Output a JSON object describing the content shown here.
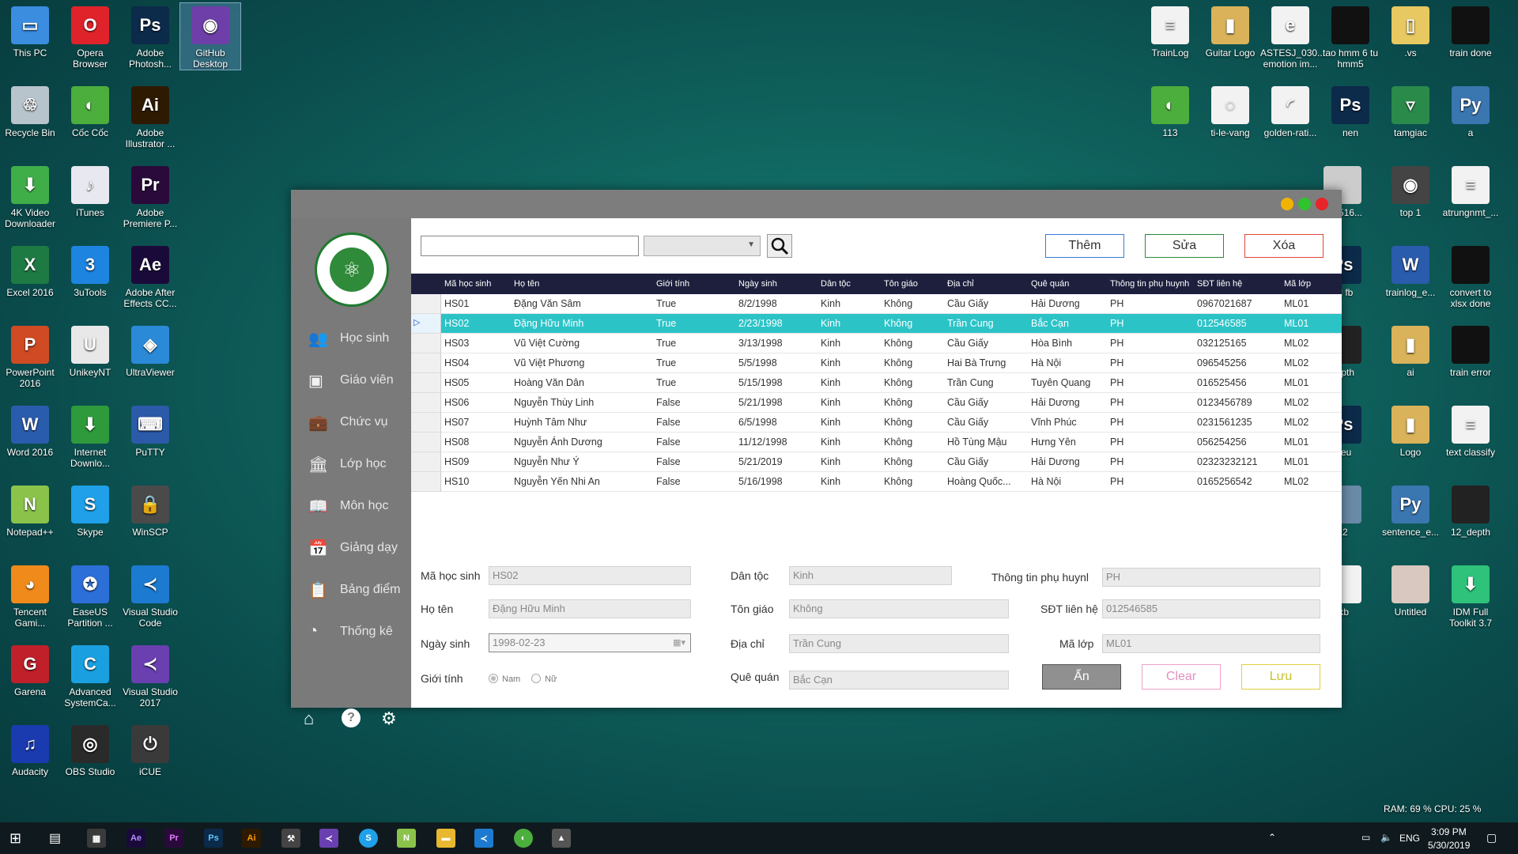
{
  "desktop": {
    "left_icons": [
      {
        "label": "This PC",
        "color": "#3b8de0",
        "glyph": "▭"
      },
      {
        "label": "Opera Browser",
        "color": "#e0232b",
        "glyph": "O"
      },
      {
        "label": "Adobe Photosh...",
        "color": "#0c2a4a",
        "glyph": "Ps"
      },
      {
        "label": "GitHub Desktop",
        "color": "#6e3fa8",
        "glyph": "◉"
      },
      {
        "label": "Recycle Bin",
        "color": "#b8c4cc",
        "glyph": "♲"
      },
      {
        "label": "Cốc Cốc",
        "color": "#4cae3c",
        "glyph": "◐"
      },
      {
        "label": "Adobe Illustrator ...",
        "color": "#2e1a00",
        "glyph": "Ai"
      },
      {
        "label": "4K Video Downloader",
        "color": "#3fae49",
        "glyph": "⬇"
      },
      {
        "label": "iTunes",
        "color": "#e8e8f0",
        "glyph": "♪"
      },
      {
        "label": "Adobe Premiere P...",
        "color": "#2a0a3a",
        "glyph": "Pr"
      },
      {
        "label": "Excel 2016",
        "color": "#1e7a43",
        "glyph": "X"
      },
      {
        "label": "3uTools",
        "color": "#1d84e0",
        "glyph": "3"
      },
      {
        "label": "Adobe After Effects CC...",
        "color": "#1a0a3a",
        "glyph": "Ae"
      },
      {
        "label": "PowerPoint 2016",
        "color": "#d04a24",
        "glyph": "P"
      },
      {
        "label": "UnikeyNT",
        "color": "#e8e8e8",
        "glyph": "U"
      },
      {
        "label": "UltraViewer",
        "color": "#2b8ad8",
        "glyph": "◈"
      },
      {
        "label": "Word 2016",
        "color": "#2a5cad",
        "glyph": "W"
      },
      {
        "label": "Internet Downlo...",
        "color": "#2e9a3c",
        "glyph": "⬇"
      },
      {
        "label": "PuTTY",
        "color": "#2b5aa8",
        "glyph": "⌨"
      },
      {
        "label": "Notepad++",
        "color": "#8bc34a",
        "glyph": "N"
      },
      {
        "label": "Skype",
        "color": "#1fa0e8",
        "glyph": "S"
      },
      {
        "label": "WinSCP",
        "color": "#4a4a4a",
        "glyph": "🔒"
      },
      {
        "label": "Tencent Gami...",
        "color": "#f08a1a",
        "glyph": "◕"
      },
      {
        "label": "EaseUS Partition ...",
        "color": "#2d6fd8",
        "glyph": "✪"
      },
      {
        "label": "Visual Studio Code",
        "color": "#1c7ad0",
        "glyph": "≺"
      },
      {
        "label": "Garena",
        "color": "#c0202a",
        "glyph": "G"
      },
      {
        "label": "Advanced SystemCa...",
        "color": "#1aa0e0",
        "glyph": "C"
      },
      {
        "label": "Visual Studio 2017",
        "color": "#6a3fb0",
        "glyph": "≺"
      },
      {
        "label": "Audacity",
        "color": "#1a3ab0",
        "glyph": "♫"
      },
      {
        "label": "OBS Studio",
        "color": "#2a2a2a",
        "glyph": "◎"
      },
      {
        "label": "iCUE",
        "color": "#3a3a3a",
        "glyph": "⏻"
      }
    ],
    "right_icons": [
      {
        "label": "TrainLog",
        "color": "#f2f2f2",
        "glyph": "≡"
      },
      {
        "label": "Guitar Logo",
        "color": "#d9b25a",
        "glyph": "▮"
      },
      {
        "label": "ASTESJ_030... emotion im...",
        "color": "#f2f2f2",
        "glyph": "e"
      },
      {
        "label": "tao hmm 6 tu hmm5",
        "color": "#111111",
        "glyph": ""
      },
      {
        "label": ".vs",
        "color": "#e8c860",
        "glyph": "▯"
      },
      {
        "label": "train done",
        "color": "#111111",
        "glyph": ""
      },
      {
        "label": "113",
        "color": "#4cae3c",
        "glyph": "◐"
      },
      {
        "label": "ti-le-vang",
        "color": "#f2f2f2",
        "glyph": "◌"
      },
      {
        "label": "golden-rati...",
        "color": "#f2f2f2",
        "glyph": "◜"
      },
      {
        "label": "nen",
        "color": "#0c2a4a",
        "glyph": "Ps"
      },
      {
        "label": "tamgiac",
        "color": "#2a8a4a",
        "glyph": "▿"
      },
      {
        "label": "a",
        "color": "#3a76b0",
        "glyph": "Py"
      },
      {
        "label": "794516...",
        "color": "#cccccc",
        "glyph": ""
      },
      {
        "label": "top 1",
        "color": "#444444",
        "glyph": "◉"
      },
      {
        "label": "atrungnmt_...",
        "color": "#f2f2f2",
        "glyph": "≡"
      },
      {
        "label": "3d fb",
        "color": "#0c2a4a",
        "glyph": "Ps"
      },
      {
        "label": "trainlog_e...",
        "color": "#2a5cad",
        "glyph": "W"
      },
      {
        "label": "convert to xlsx done",
        "color": "#111111",
        "glyph": ""
      },
      {
        "label": "depth",
        "color": "#222222",
        "glyph": ""
      },
      {
        "label": "ai",
        "color": "#d9b25a",
        "glyph": "▮"
      },
      {
        "label": "train error",
        "color": "#111111",
        "glyph": ""
      },
      {
        "label": "hieu",
        "color": "#0c2a4a",
        "glyph": "Ps"
      },
      {
        "label": "Logo",
        "color": "#d9b25a",
        "glyph": "▮"
      },
      {
        "label": "text classify",
        "color": "#f2f2f2",
        "glyph": "≡"
      },
      {
        "label": "12",
        "color": "#6a8aa8",
        "glyph": ""
      },
      {
        "label": "sentence_e...",
        "color": "#3a76b0",
        "glyph": "Py"
      },
      {
        "label": "12_depth",
        "color": "#222222",
        "glyph": ""
      },
      {
        "label": "tkb",
        "color": "#f2f2f2",
        "glyph": ""
      },
      {
        "label": "Untitled",
        "color": "#d8c8c0",
        "glyph": ""
      },
      {
        "label": "IDM Full Toolkit 3.7",
        "color": "#2ec27a",
        "glyph": "⬇"
      }
    ],
    "sysmon": "RAM: 69 %  CPU: 25 %"
  },
  "app": {
    "sidebar": {
      "items": [
        {
          "label": "Học sinh",
          "icon": "👥"
        },
        {
          "label": "Giáo viên",
          "icon": "▣"
        },
        {
          "label": "Chức vụ",
          "icon": "💼"
        },
        {
          "label": "Lớp học",
          "icon": "🏛"
        },
        {
          "label": "Môn học",
          "icon": "📖"
        },
        {
          "label": "Giảng dạy",
          "icon": "📅"
        },
        {
          "label": "Bảng điểm",
          "icon": "📋"
        },
        {
          "label": "Thống kê",
          "icon": "◔"
        }
      ]
    },
    "toolbar": {
      "search_value": "",
      "filter_value": "",
      "add_label": "Thêm",
      "edit_label": "Sửa",
      "delete_label": "Xóa"
    },
    "table": {
      "columns": [
        "Mã học sinh",
        "Họ tên",
        "Giới tính",
        "Ngày sinh",
        "Dân tộc",
        "Tôn giáo",
        "Địa chỉ",
        "Quê quán",
        "Thông tin phụ huynh",
        "SĐT liên hệ",
        "Mã lớp"
      ],
      "rows": [
        [
          "HS01",
          "Đặng Văn Sâm",
          "True",
          "8/2/1998",
          "Kinh",
          "Không",
          "Cầu Giấy",
          "Hải Dương",
          "PH",
          "0967021687",
          "ML01"
        ],
        [
          "HS02",
          "Đặng Hữu Minh",
          "True",
          "2/23/1998",
          "Kinh",
          "Không",
          "Trần Cung",
          "Bắc Cạn",
          "PH",
          "012546585",
          "ML01"
        ],
        [
          "HS03",
          "Vũ Việt Cường",
          "True",
          "3/13/1998",
          "Kinh",
          "Không",
          "Cầu Giấy",
          "Hòa Bình",
          "PH",
          "032125165",
          "ML02"
        ],
        [
          "HS04",
          "Vũ Việt Phương",
          "True",
          "5/5/1998",
          "Kinh",
          "Không",
          "Hai Bà Trưng",
          "Hà Nội",
          "PH",
          "096545256",
          "ML02"
        ],
        [
          "HS05",
          "Hoàng Văn Dân",
          "True",
          "5/15/1998",
          "Kinh",
          "Không",
          "Trần Cung",
          "Tuyên Quang",
          "PH",
          "016525456",
          "ML01"
        ],
        [
          "HS06",
          "Nguyễn Thùy Linh",
          "False",
          "5/21/1998",
          "Kinh",
          "Không",
          "Cầu Giấy",
          "Hải Dương",
          "PH",
          "0123456789",
          "ML02"
        ],
        [
          "HS07",
          "Huỳnh Tâm Như",
          "False",
          "6/5/1998",
          "Kinh",
          "Không",
          "Cầu Giấy",
          "Vĩnh Phúc",
          "PH",
          "0231561235",
          "ML02"
        ],
        [
          "HS08",
          "Nguyễn Ánh Dương",
          "False",
          "11/12/1998",
          "Kinh",
          "Không",
          "Hồ Tùng Mậu",
          "Hưng Yên",
          "PH",
          "056254256",
          "ML01"
        ],
        [
          "HS09",
          "Nguyễn Như Ý",
          "False",
          "5/21/2019",
          "Kinh",
          "Không",
          "Cầu Giấy",
          "Hải Dương",
          "PH",
          "02323232121",
          "ML01"
        ],
        [
          "HS10",
          "Nguyễn Yến Nhi An",
          "False",
          "5/16/1998",
          "Kinh",
          "Không",
          "Hoàng Quốc...",
          "Hà Nội",
          "PH",
          "0165256542",
          "ML02"
        ]
      ]
    },
    "form": {
      "ma_hoc_sinh_label": "Mã học sinh",
      "ma_hoc_sinh": "HS02",
      "ho_ten_label": "Họ tên",
      "ho_ten": "Đặng Hữu Minh",
      "ngay_sinh_label": "Ngày sinh",
      "ngay_sinh": "1998-02-23",
      "gioi_tinh_label": "Giới tính",
      "gender_male": "Nam",
      "gender_female": "Nữ",
      "dan_toc_label": "Dân tộc",
      "dan_toc": "Kinh",
      "ton_giao_label": "Tôn giáo",
      "ton_giao": "Không",
      "dia_chi_label": "Địa chỉ",
      "dia_chi": "Trần Cung",
      "que_quan_label": "Quê quán",
      "que_quan": "Bắc Cạn",
      "phu_huynh_label": "Thông tin phụ huynl",
      "phu_huynh": "PH",
      "sdt_label": "SĐT liên hệ",
      "sdt": "012546585",
      "ma_lop_label": "Mã lớp",
      "ma_lop": "ML01",
      "hide_label": "Ẩn",
      "clear_label": "Clear",
      "save_label": "Lưu"
    }
  },
  "taskbar": {
    "lang": "ENG",
    "time": "3:09 PM",
    "date": "5/30/2019"
  }
}
